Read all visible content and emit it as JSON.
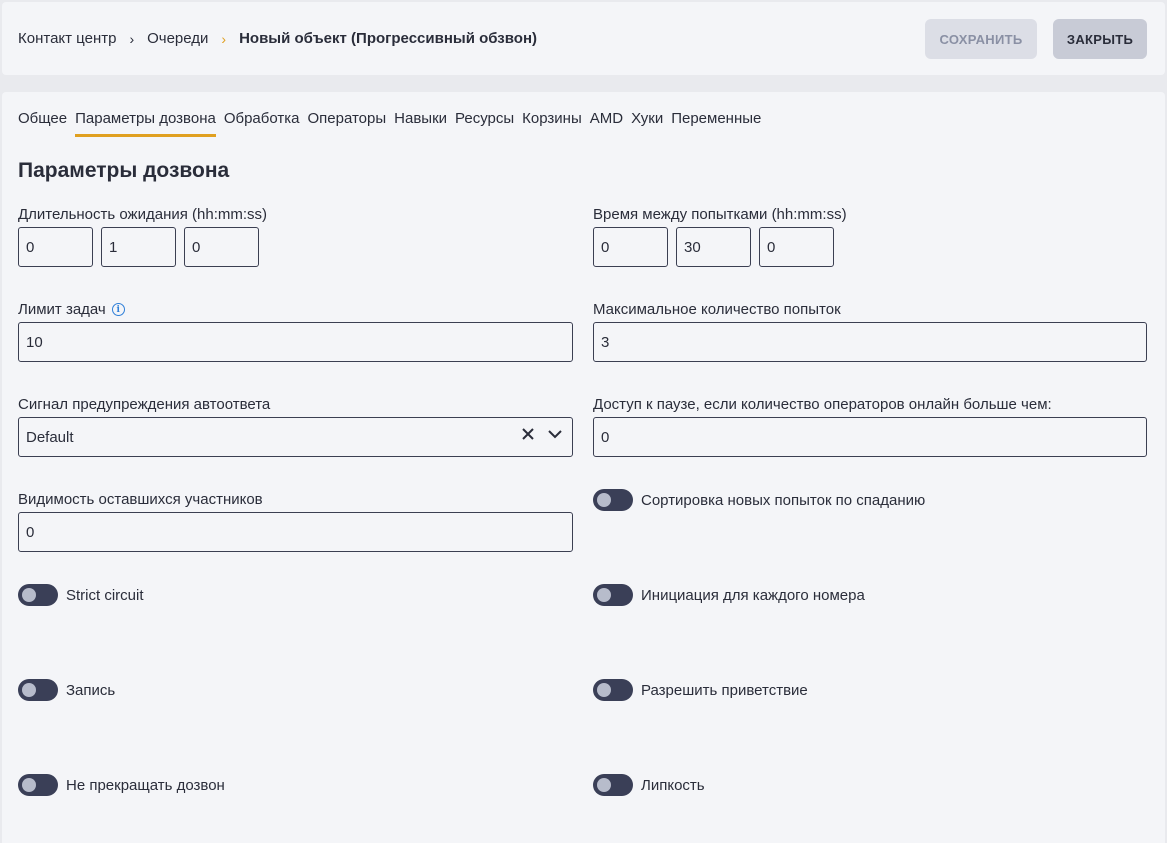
{
  "breadcrumb": {
    "items": [
      "Контакт центр",
      "Очереди",
      "Новый объект (Прогрессивный обзвон)"
    ],
    "separator": "›"
  },
  "actions": {
    "save_label": "СОХРАНИТЬ",
    "close_label": "ЗАКРЫТЬ"
  },
  "tabs": [
    "Общее",
    "Параметры дозвона",
    "Обработка",
    "Операторы",
    "Навыки",
    "Ресурсы",
    "Корзины",
    "AMD",
    "Хуки",
    "Переменные"
  ],
  "active_tab": "Параметры дозвона",
  "section_title": "Параметры дозвона",
  "fields": {
    "wait_duration": {
      "label": "Длительность ожидания (hh:mm:ss)",
      "h": "0",
      "m": "1",
      "s": "0"
    },
    "retry_interval": {
      "label": "Время между попытками (hh:mm:ss)",
      "h": "0",
      "m": "30",
      "s": "0"
    },
    "task_limit": {
      "label": "Лимит задач",
      "value": "10"
    },
    "max_attempts": {
      "label": "Максимальное количество попыток",
      "value": "3"
    },
    "answer_signal": {
      "label": "Сигнал предупреждения автоответа",
      "value": "Default"
    },
    "pause_access": {
      "label": "Доступ к паузе, если количество операторов онлайн больше чем:",
      "value": "0"
    },
    "remaining_visibility": {
      "label": "Видимость оставшихся участников",
      "value": "0"
    }
  },
  "toggles": {
    "sort_desc": {
      "label": "Сортировка новых попыток по спаданию",
      "on": false
    },
    "strict_circuit": {
      "label": "Strict circuit",
      "on": false
    },
    "init_each": {
      "label": "Инициация для каждого номера",
      "on": false
    },
    "record": {
      "label": "Запись",
      "on": false
    },
    "allow_greeting": {
      "label": "Разрешить приветствие",
      "on": false
    },
    "no_stop": {
      "label": "Не прекращать дозвон",
      "on": false
    },
    "sticky": {
      "label": "Липкость",
      "on": false
    }
  },
  "colors": {
    "accent": "#e0a020",
    "toggle_off": "#3a3f57",
    "info": "#2f7fd8"
  }
}
